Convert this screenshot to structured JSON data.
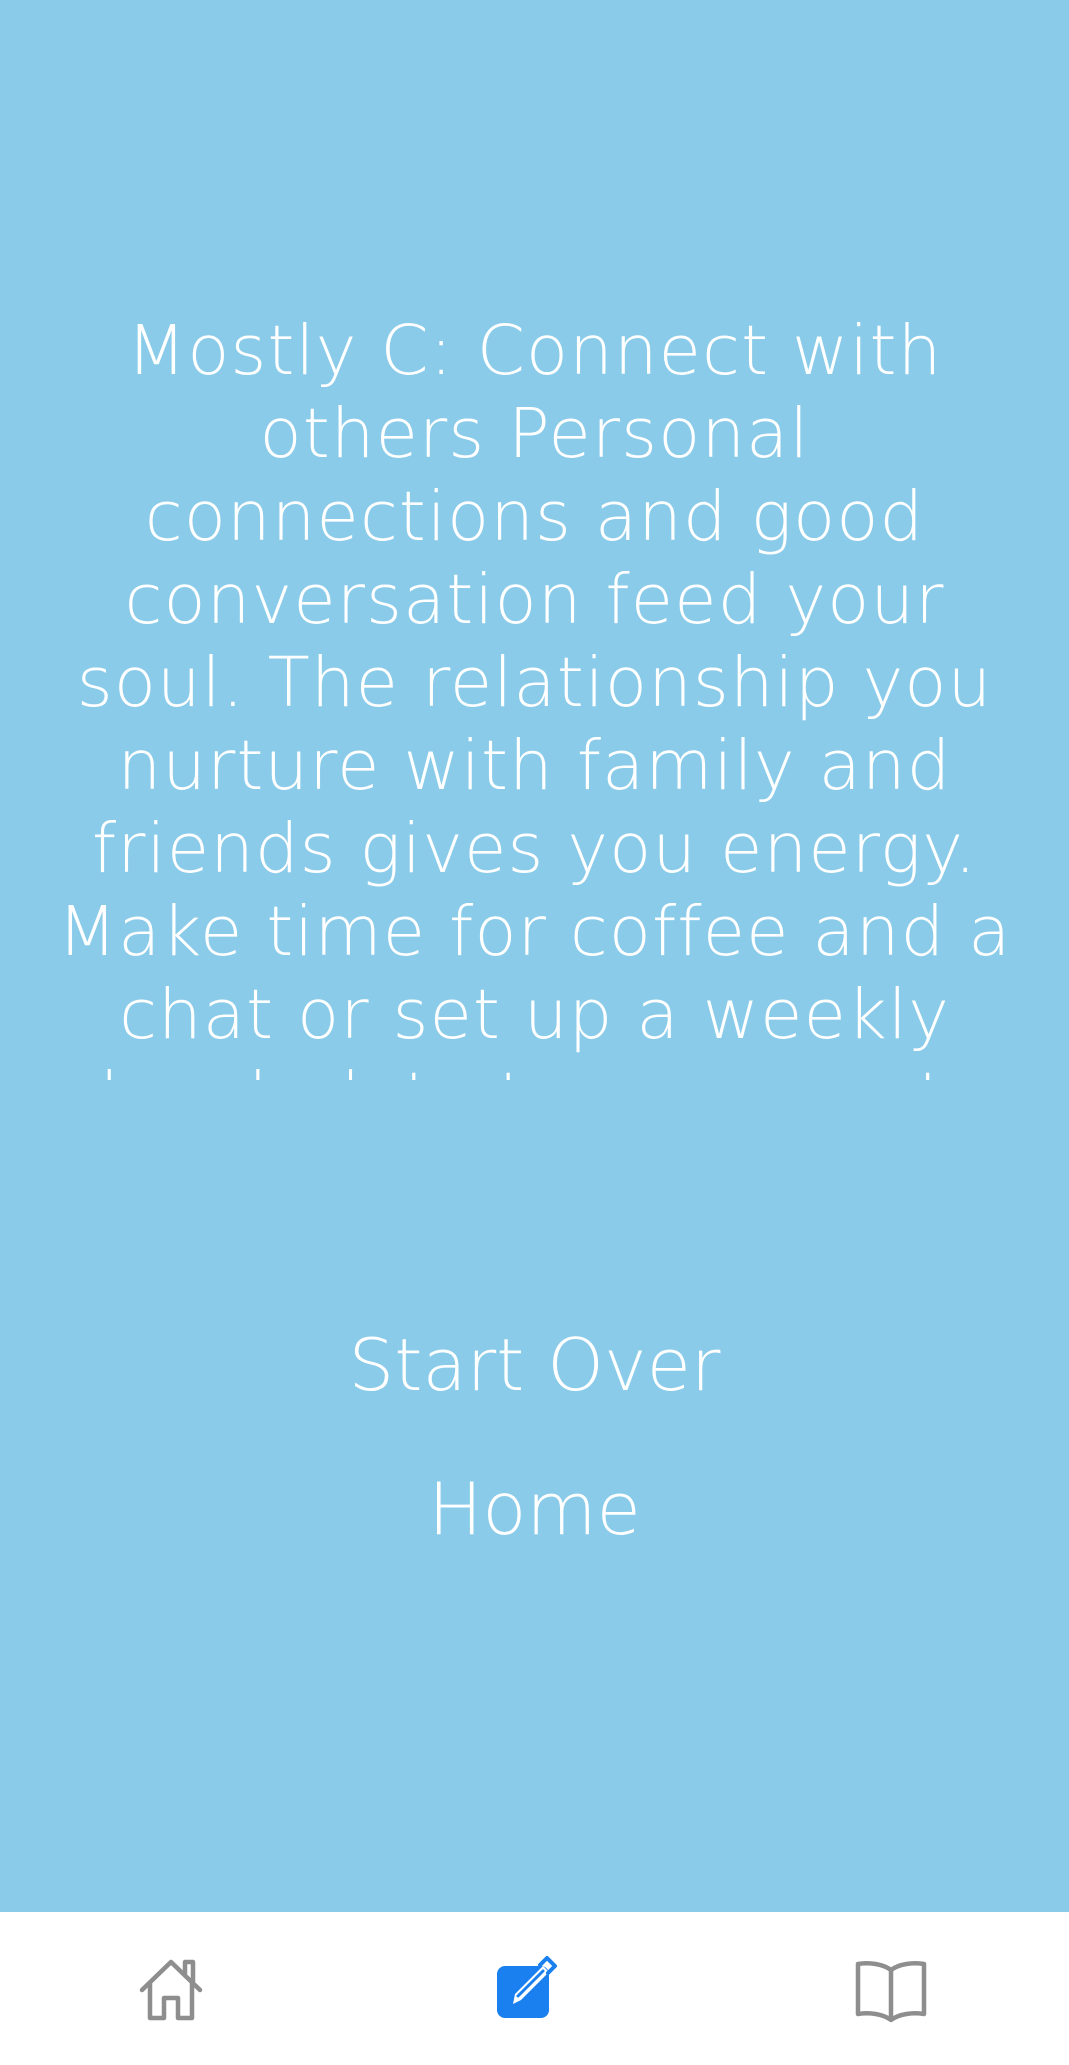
{
  "result": {
    "text": "Mostly C: Connect with others Personal connections and good conversation feed your soul. The relationship you nurture with family and friends gives you energy. Make time for coffee and a chat or set up a weekly lunch date to reconnect."
  },
  "actions": {
    "start_over_label": "Start Over",
    "home_label": "Home"
  },
  "tabbar": {
    "items": [
      {
        "icon": "home-icon",
        "active": false
      },
      {
        "icon": "compose-icon",
        "active": true
      },
      {
        "icon": "book-icon",
        "active": false
      }
    ]
  },
  "colors": {
    "background": "#89CBE9",
    "text": "#FFFFFF",
    "tabbar_background": "#FFFFFF",
    "tab_active": "#1A7FEF",
    "tab_inactive": "#8E8E8E"
  }
}
